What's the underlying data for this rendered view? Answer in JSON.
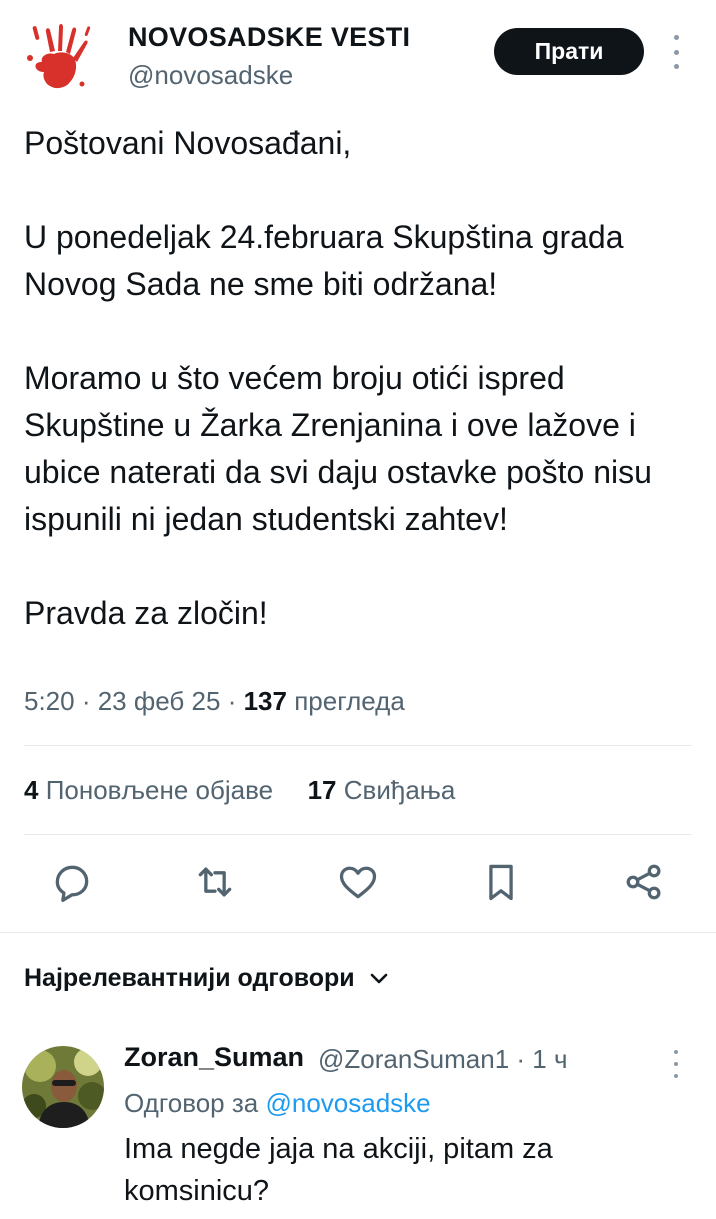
{
  "author": {
    "name": "NOVOSADSKE VESTI",
    "handle": "@novosadske",
    "avatar_icon": "red-handprint-icon",
    "accent_color": "#d8302a"
  },
  "header": {
    "follow_label": "Прати",
    "more_icon": "more-vertical-icon"
  },
  "tweet": {
    "paragraphs": [
      "Poštovani Novosađani,",
      "U ponedeljak 24.februara Skupština grada Novog Sada ne sme biti održana!",
      "Moramo u što većem broju otići ispred Skupštine u Žarka Zrenjanina i ove lažove i ubice naterati da svi daju ostavke pošto nisu ispunili ni jedan studentski zahtev!",
      "Pravda za zločin!"
    ],
    "time": "5:20",
    "date": "23 феб 25",
    "views_count": "137",
    "views_label": "прегледа",
    "separator": " · "
  },
  "stats": {
    "reposts_count": "4",
    "reposts_label": "Поновљене објаве",
    "likes_count": "17",
    "likes_label": "Свиђања"
  },
  "actions": {
    "reply_icon": "reply-icon",
    "repost_icon": "repost-icon",
    "like_icon": "like-icon",
    "bookmark_icon": "bookmark-icon",
    "share_icon": "share-icon",
    "icon_color": "#536471"
  },
  "replies_section": {
    "sort_label": "Најрелевантнији одговори"
  },
  "reply": {
    "name": "Zoran_Suman",
    "handle": "@ZoranSuman1",
    "time": "1 ч",
    "reply_to_prefix": "Одговор за",
    "reply_to_handle": "@novosadske",
    "text": "Ima negde jaja na akciji, pitam za komsinicu?",
    "link_color": "#1d9bf0"
  }
}
